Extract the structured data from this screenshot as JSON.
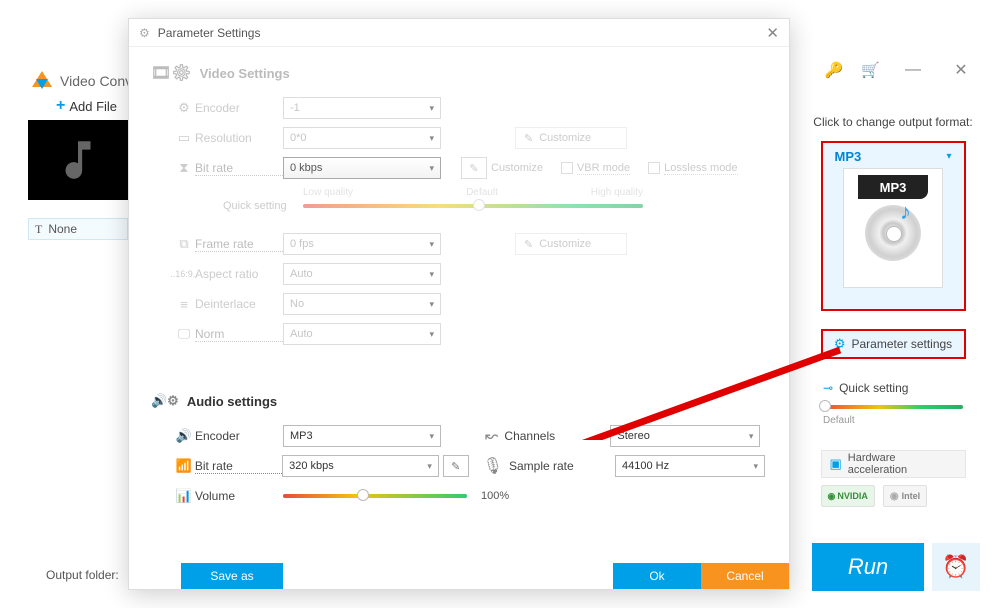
{
  "bg": {
    "title": "Video Conv",
    "addFile": "Add File",
    "thumbLabel": "None",
    "outputFolder": "Output folder:"
  },
  "rightPane": {
    "heading": "Click to change output format:",
    "format": "MP3",
    "badge": "MP3",
    "paramBtn": "Parameter settings",
    "quick": "Quick setting",
    "quickDefault": "Default",
    "hw": "Hardware acceleration",
    "nvidia": "NVIDIA",
    "intel": "Intel"
  },
  "runBtn": "Run",
  "dialog": {
    "title": "Parameter Settings",
    "video": {
      "heading": "Video Settings",
      "encoder": {
        "label": "Encoder",
        "value": "-1"
      },
      "resolution": {
        "label": "Resolution",
        "value": "0*0",
        "customize": "Customize"
      },
      "bitrate": {
        "label": "Bit rate",
        "value": "0 kbps",
        "customize": "Customize",
        "vbr": "VBR mode",
        "lossless": "Lossless mode"
      },
      "quickSetting": "Quick setting",
      "qLow": "Low quality",
      "qDef": "Default",
      "qHigh": "High quality",
      "framerate": {
        "label": "Frame rate",
        "value": "0 fps",
        "customize": "Customize"
      },
      "aspect": {
        "label": "Aspect ratio",
        "value": "Auto"
      },
      "deint": {
        "label": "Deinterlace",
        "value": "No"
      },
      "norm": {
        "label": "Norm",
        "value": "Auto"
      }
    },
    "audio": {
      "heading": "Audio settings",
      "encoder": {
        "label": "Encoder",
        "value": "MP3"
      },
      "channels": {
        "label": "Channels",
        "value": "Stereo"
      },
      "bitrate": {
        "label": "Bit rate",
        "value": "320 kbps"
      },
      "samplerate": {
        "label": "Sample rate",
        "value": "44100 Hz"
      },
      "volume": {
        "label": "Volume",
        "value": "100%"
      }
    },
    "footer": {
      "save": "Save as",
      "ok": "Ok",
      "cancel": "Cancel"
    }
  }
}
